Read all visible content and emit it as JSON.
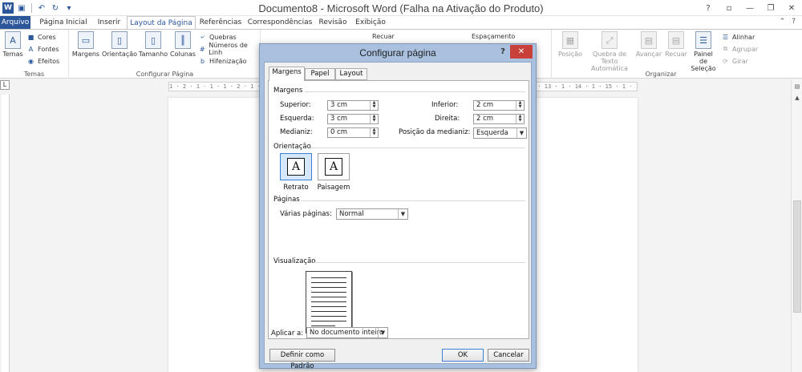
{
  "titlebar": {
    "title": "Documento8 - Microsoft Word (Falha na Ativação do Produto)",
    "app_icon": "W",
    "qat": [
      "save-icon",
      "undo-icon",
      "redo-icon",
      "customize-icon"
    ]
  },
  "tabs": [
    {
      "label": "Arquivo"
    },
    {
      "label": "Página Inicial"
    },
    {
      "label": "Inserir"
    },
    {
      "label": "Layout da Página"
    },
    {
      "label": "Referências"
    },
    {
      "label": "Correspondências"
    },
    {
      "label": "Revisão"
    },
    {
      "label": "Exibição"
    }
  ],
  "ribbon": {
    "temas": {
      "label": "Temas",
      "temas_btn": "Temas",
      "cores": "Cores",
      "fontes": "Fontes",
      "efeitos": "Efeitos"
    },
    "configurar": {
      "label": "Configurar Página",
      "margens": "Margens",
      "orientacao": "Orientação",
      "tamanho": "Tamanho",
      "colunas": "Colunas",
      "quebras": "Quebras",
      "numeros": "Números de Linh",
      "hifenizacao": "Hifenização"
    },
    "paragrafo": {
      "recuar": "Recuar",
      "espacamento": "Espaçamento"
    },
    "organizar": {
      "label": "Organizar",
      "posicao": "Posição",
      "quebra_texto_1": "Quebra de Texto",
      "quebra_texto_2": "Automática",
      "avancar": "Avançar",
      "recuar": "Recuar",
      "painel_1": "Painel de",
      "painel_2": "Seleção",
      "alinhar": "Alinhar",
      "agrupar": "Agrupar",
      "girar": "Girar"
    }
  },
  "ruler": {
    "corner": "L",
    "h_text": "1 · 2 · 1 · 1 · 1 · 2 · 1 · 3 · 1 · 4 · 1 · 5 · 1 · 6 · 1 · 7 · 1 · 8 · 1 · 9 · 1 · 10 · 1 · 11 · 1 · 12 · 1 · 13 · 1 · 14 · 1 · 15 · 1 · 16 · 1 · 17 · 1 · 18"
  },
  "dialog": {
    "title": "Configurar página",
    "help": "?",
    "tabs": [
      "Margens",
      "Papel",
      "Layout"
    ],
    "margins": {
      "section": "Margens",
      "superior_label": "Superior:",
      "superior": "3 cm",
      "inferior_label": "Inferior:",
      "inferior": "2 cm",
      "esquerda_label": "Esquerda:",
      "esquerda": "3 cm",
      "direita_label": "Direita:",
      "direita": "2 cm",
      "medianiz_label": "Medianiz:",
      "medianiz": "0 cm",
      "posicao_label": "Posição da medianiz:",
      "posicao": "Esquerda"
    },
    "orientation": {
      "section": "Orientação",
      "retrato": "Retrato",
      "paisagem": "Paisagem",
      "glyph": "A"
    },
    "pages": {
      "section": "Páginas",
      "label": "Várias páginas:",
      "value": "Normal"
    },
    "preview": {
      "section": "Visualização"
    },
    "apply": {
      "label": "Aplicar a:",
      "value": "No documento inteiro"
    },
    "buttons": {
      "default": "Definir como Padrão",
      "ok": "OK",
      "cancel": "Cancelar"
    }
  }
}
